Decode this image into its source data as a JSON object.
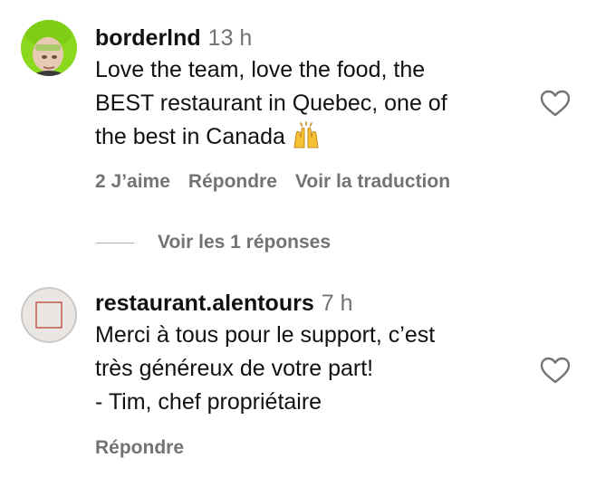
{
  "comments": [
    {
      "username": "borderlnd",
      "time": "13 h",
      "text": "Love the team, love the food, the\nBEST restaurant in Quebec, one of\nthe best in Canada",
      "emoji": "raising-hands",
      "likes": "2 J’aime",
      "reply": "Répondre",
      "translate": "Voir la traduction"
    },
    {
      "username": "restaurant.alentours",
      "time": "7 h",
      "text": "Merci à tous pour le support, c’est\ntrès généreux de votre part!\n- Tim, chef propriétaire",
      "reply": "Répondre"
    }
  ],
  "view_replies": "Voir les 1 réponses",
  "icons": {
    "like": "heart-outline-icon"
  },
  "colors": {
    "secondary_text": "#737373",
    "avatar1_bg": "#8bd81e"
  }
}
